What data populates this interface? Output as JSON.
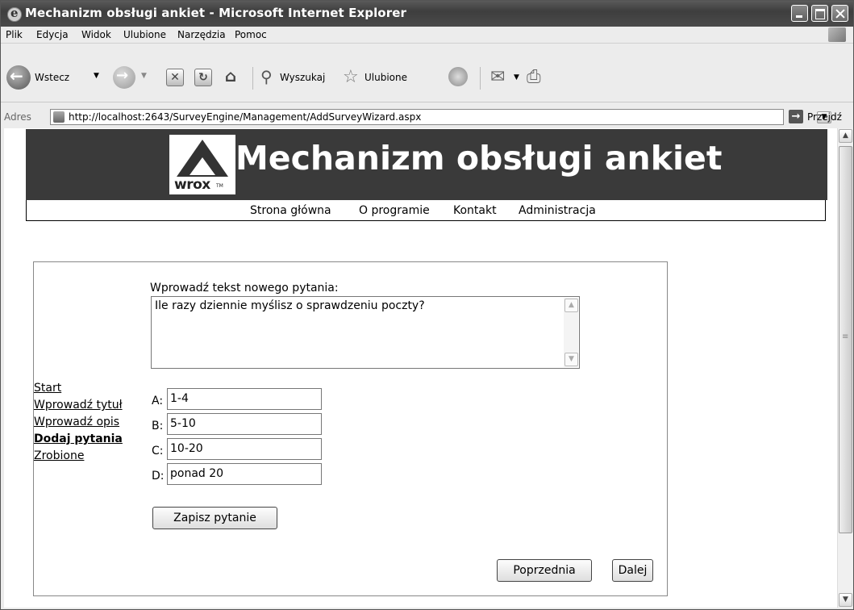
{
  "window": {
    "title": "Mechanizm obsługi ankiet - Microsoft Internet Explorer"
  },
  "menu": [
    "Plik",
    "Edycja",
    "Widok",
    "Ulubione",
    "Narzędzia",
    "Pomoc"
  ],
  "toolbar": {
    "back": "Wstecz",
    "search": "Wyszukaj",
    "favorites": "Ulubione"
  },
  "address": {
    "label": "Adres",
    "url": "http://localhost:2643/SurveyEngine/Management/AddSurveyWizard.aspx",
    "go": "Przejdź"
  },
  "site": {
    "logo_text": "wrox",
    "logo_tm": "TM",
    "title": "Mechanizm obsługi ankiet",
    "nav": [
      "Strona główna",
      "O programie",
      "Kontakt",
      "Administracja"
    ]
  },
  "wizard": {
    "steps": [
      {
        "label": "Start",
        "current": false
      },
      {
        "label": "Wprowadź tytuł",
        "current": false
      },
      {
        "label": "Wprowadź opis",
        "current": false
      },
      {
        "label": "Dodaj pytania",
        "current": true
      },
      {
        "label": "Zrobione",
        "current": false
      }
    ],
    "question_label": "Wprowadź tekst nowego pytania:",
    "question_text": "Ile razy dziennie myślisz o sprawdzeniu poczty?",
    "answers": [
      {
        "label": "A:",
        "value": "1-4"
      },
      {
        "label": "B:",
        "value": "5-10"
      },
      {
        "label": "C:",
        "value": "10-20"
      },
      {
        "label": "D:",
        "value": "ponad 20"
      }
    ],
    "save_button": "Zapisz pytanie",
    "prev_button": "Poprzednia",
    "next_button": "Dalej"
  }
}
